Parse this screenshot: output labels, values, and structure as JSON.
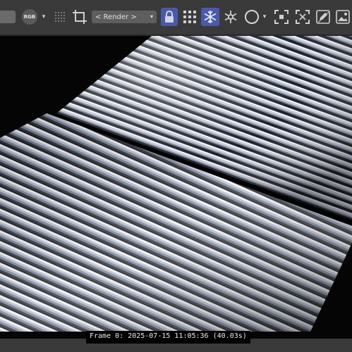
{
  "toolbar": {
    "channel_label": "RGB",
    "render_dropdown_label": "< Render >",
    "caret": "▾",
    "icons": [
      "left-dropdown",
      "rgb-channel-icon",
      "dot-grid-icon",
      "crop-icon",
      "render-select",
      "lock-icon",
      "grid-icon",
      "snowflake-icon",
      "sparkle-icon",
      "circle-icon",
      "focus-region-icon",
      "region-select-icon",
      "pen-edit-icon",
      "image-icon"
    ],
    "active_color": "#4b5aa8"
  },
  "viewport": {
    "background": "#050505",
    "surface_color": "#9aa3b5"
  },
  "status": {
    "text": "Frame  0:  2025-07-15  11:05:36  (40.03s)"
  }
}
